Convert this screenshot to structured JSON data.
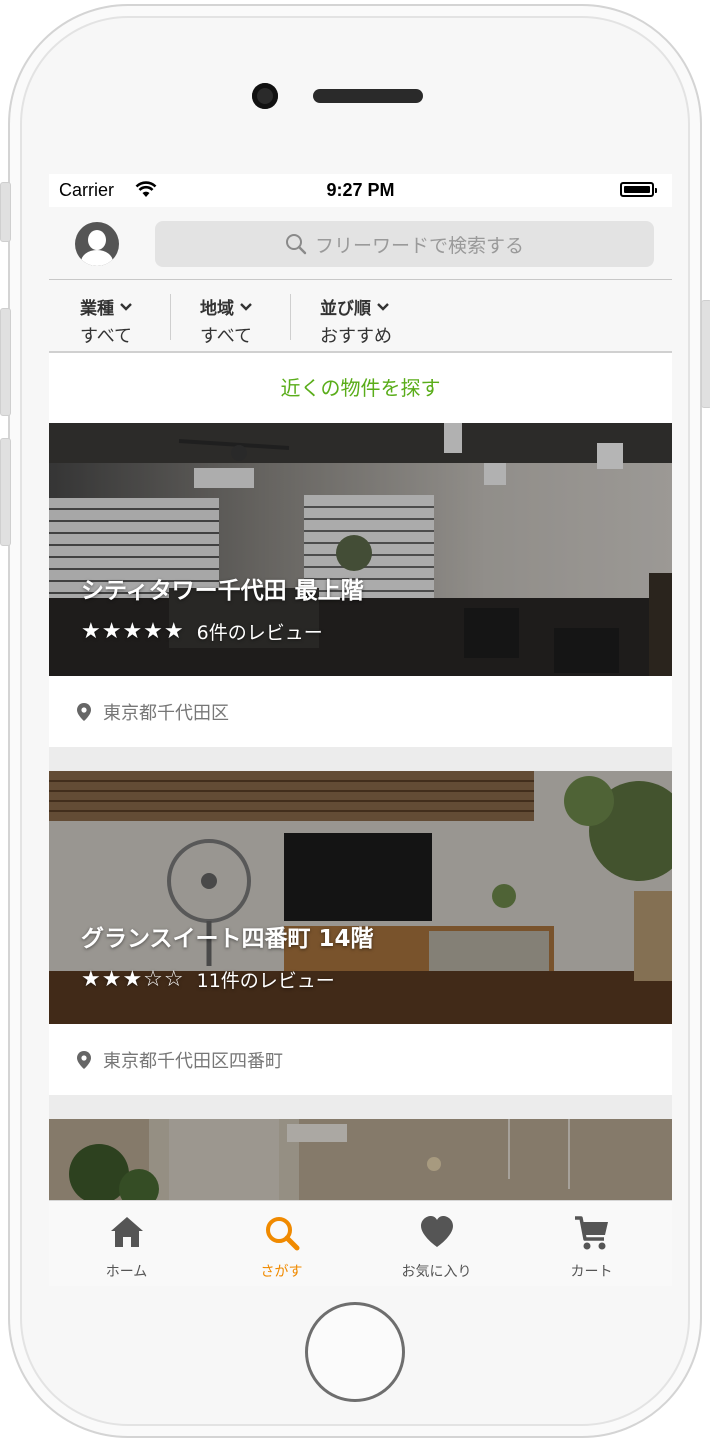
{
  "status_bar": {
    "carrier": "Carrier",
    "time": "9:27 PM"
  },
  "search": {
    "placeholder": "フリーワードで検索する"
  },
  "filters": [
    {
      "title": "業種",
      "value": "すべて"
    },
    {
      "title": "地域",
      "value": "すべて"
    },
    {
      "title": "並び順",
      "value": "おすすめ"
    }
  ],
  "nearby_link": "近くの物件を探す",
  "listings": [
    {
      "title": "シティタワー千代田 最上階",
      "stars": "★★★★★",
      "rating": 5,
      "reviews": "6件のレビュー",
      "location": "東京都千代田区"
    },
    {
      "title": "グランスイート四番町 14階",
      "stars": "★★★☆☆",
      "rating": 3,
      "reviews": "11件のレビュー",
      "location": "東京都千代田区四番町"
    }
  ],
  "tabs": [
    {
      "label": "ホーム",
      "icon": "home-icon"
    },
    {
      "label": "さがす",
      "icon": "search-icon",
      "active": true
    },
    {
      "label": "お気に入り",
      "icon": "heart-icon"
    },
    {
      "label": "カート",
      "icon": "cart-icon"
    }
  ],
  "colors": {
    "accent_green": "#5aad1a",
    "active_tab": "#f08a00",
    "icon_gray": "#555555"
  }
}
